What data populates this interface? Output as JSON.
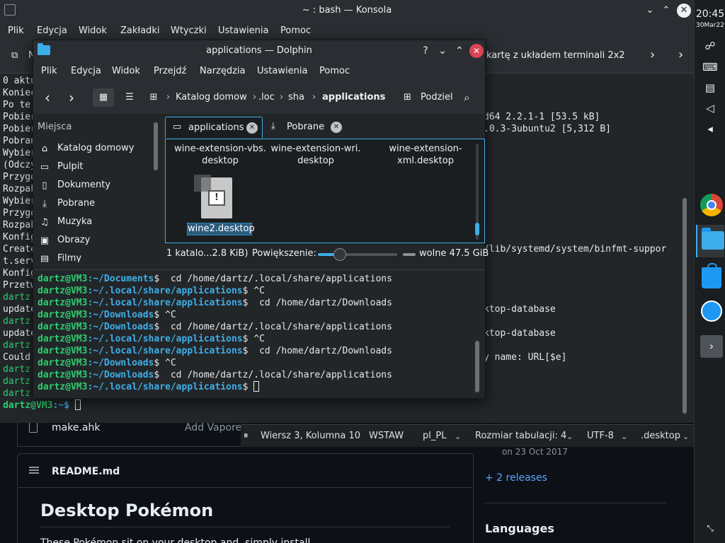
{
  "github": {
    "file_name": "make.ahk",
    "file_commit": "Add Vaporeon",
    "readme_label": "README.md",
    "readme_title": "Desktop Pokémon",
    "readme_para": "These Pokémon sit on your desktop and, simply install",
    "release_date": "on 23 Oct 2017",
    "releases_link": "+ 2 releases",
    "languages_heading": "Languages"
  },
  "kate_status": {
    "position": "Wiersz 3, Kolumna 10",
    "mode": "WSTAW",
    "language": "pl_PL",
    "tab_size": "Rozmiar tabulacji: 4",
    "encoding": "UTF-8",
    "file_type": ".desktop"
  },
  "konsole": {
    "title": "~ : bash — Konsola",
    "menu": [
      "Plik",
      "Edycja",
      "Widok",
      "Zakładki",
      "Wtyczki",
      "Ustawienia",
      "Pomoc"
    ],
    "toolbar_new_tab": "N",
    "toolbar_split": "kartę z układem terminali 2x2",
    "left_lines": [
      "0 aktu",
      "Koniec",
      "Po te",
      "Pobier",
      "Pobier",
      "Pobran",
      "Wybier",
      "(Odczy",
      "Przygo",
      "Rozpak",
      "Wybier",
      "Przygo",
      "Rozpak",
      "Konfig",
      "Create",
      "t.serv",
      "Konfig",
      "Przetw",
      "dartz",
      "update",
      "dartz",
      "update",
      "dartz",
      "Could",
      "dartz",
      "dartz",
      "dartz"
    ],
    "right_lines": [
      {
        "row": 3,
        "text": "d64 2.2.1-1 [53.5 kB]"
      },
      {
        "row": 4,
        "text": ".0.3-3ubuntu2 [5,312 B]"
      },
      {
        "row": 14,
        "text": "/lib/systemd/system/binfmt-suppor"
      },
      {
        "row": 19,
        "text": "ktop-database"
      },
      {
        "row": 21,
        "text": "ktop-database"
      },
      {
        "row": 23,
        "text": "y name: URL[$e]"
      }
    ],
    "final_prompt_user": "dartz@VM3",
    "final_prompt_path": ":~$"
  },
  "dolphin": {
    "title": "applications — Dolphin",
    "menu": [
      "Plik",
      "Edycja",
      "Widok",
      "Przejdź",
      "Narzędzia",
      "Ustawienia",
      "Pomoc"
    ],
    "breadcrumb": [
      "Katalog domow",
      ".loc",
      "sha",
      "applications"
    ],
    "split_label": "Podziel",
    "places_header": "Miejsca",
    "places": [
      "Katalog domowy",
      "Pulpit",
      "Dokumenty",
      "Pobrane",
      "Muzyka",
      "Obrazy",
      "Filmy"
    ],
    "tabs": [
      "applications",
      "Pobrane"
    ],
    "files": [
      {
        "line1": "wine-extension-vbs.",
        "line2": "desktop"
      },
      {
        "line1": "wine-extension-wri.",
        "line2": "desktop"
      },
      {
        "line1": "wine-extension-",
        "line2": "xml.desktop"
      }
    ],
    "selected_file": "wine2.desktop",
    "status_count": "1 katalo...2.8 KiB)",
    "zoom_label": "Powiększenie:",
    "free_space": "wolne 47.5 GiB"
  },
  "dolphin_terminal": {
    "lines": [
      {
        "user": "dartz@VM3",
        "path": ":~/Documents",
        "cmd": "$  cd /home/dartz/.local/share/applications"
      },
      {
        "user": "dartz@VM3",
        "path": ":~/.local/share/applications",
        "cmd": "$ ^C"
      },
      {
        "user": "dartz@VM3",
        "path": ":~/.local/share/applications",
        "cmd": "$  cd /home/dartz/Downloads"
      },
      {
        "user": "dartz@VM3",
        "path": ":~/Downloads",
        "cmd": "$ ^C"
      },
      {
        "user": "dartz@VM3",
        "path": ":~/Downloads",
        "cmd": "$  cd /home/dartz/.local/share/applications"
      },
      {
        "user": "dartz@VM3",
        "path": ":~/.local/share/applications",
        "cmd": "$ ^C"
      },
      {
        "user": "dartz@VM3",
        "path": ":~/.local/share/applications",
        "cmd": "$  cd /home/dartz/Downloads"
      },
      {
        "user": "dartz@VM3",
        "path": ":~/Downloads",
        "cmd": "$ ^C"
      },
      {
        "user": "dartz@VM3",
        "path": ":~/Downloads",
        "cmd": "$  cd /home/dartz/.local/share/applications"
      },
      {
        "user": "dartz@VM3",
        "path": ":~/.local/share/applications",
        "cmd": "$ "
      }
    ]
  },
  "panel": {
    "time": "20:45",
    "date": "30Mar22",
    "tasks": [
      "chrome-icon",
      "dolphin-icon",
      "discover-icon",
      "kde-connect-icon",
      "more-icon"
    ]
  }
}
